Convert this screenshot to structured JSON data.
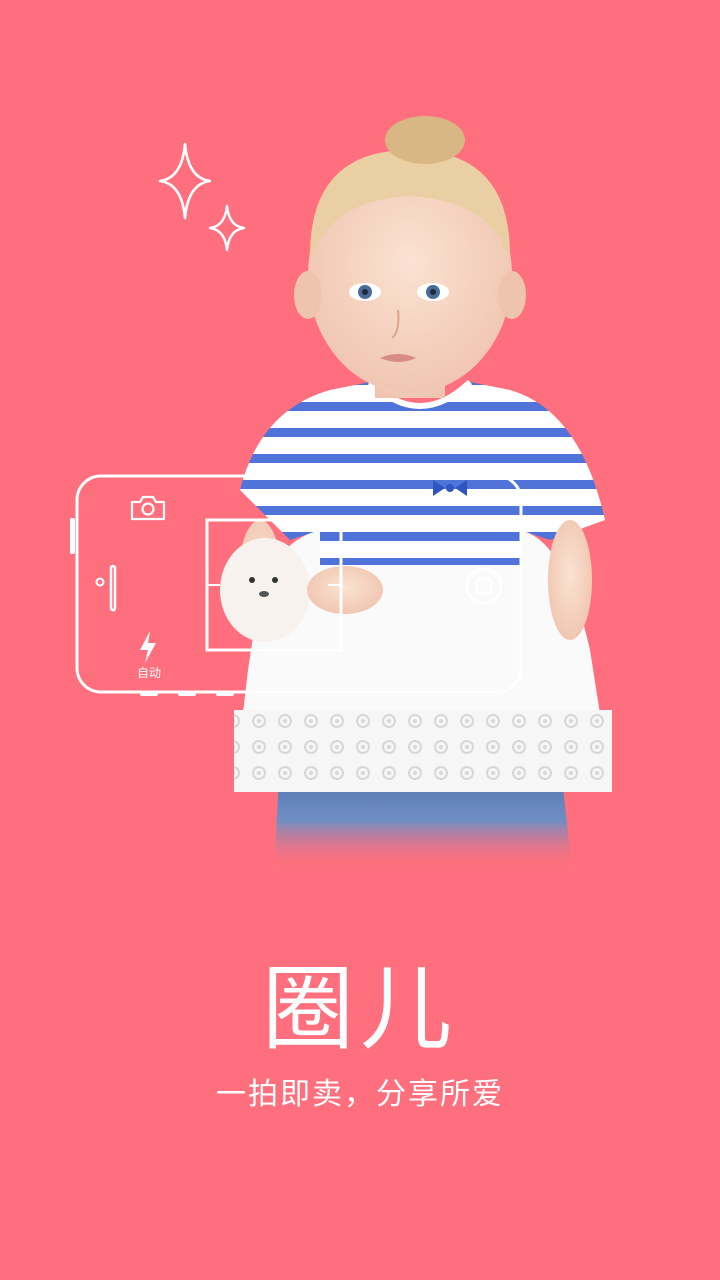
{
  "splash": {
    "title": "圈儿",
    "subtitle": "一拍即卖，分享所爱",
    "camera_mode_label": "自动"
  },
  "colors": {
    "background": "#FF6F7D",
    "foreground": "#FFFFFF"
  },
  "icons": [
    "sparkle-icon",
    "camera-icon",
    "flash-icon",
    "shutter-button-icon"
  ],
  "image": {
    "subject": "toddler-in-striped-shirt-holding-plush-seal"
  }
}
